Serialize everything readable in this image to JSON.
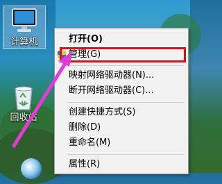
{
  "desktop": {
    "icons": [
      {
        "label": "计算机"
      },
      {
        "label": "回收站"
      }
    ]
  },
  "context_menu": {
    "items": [
      {
        "label": "打开(O)"
      },
      {
        "label": "管理(G)"
      },
      {
        "label": "映射网络驱动器(N)..."
      },
      {
        "label": "断开网络驱动器(C)..."
      },
      {
        "label": "创建快捷方式(S)"
      },
      {
        "label": "删除(D)"
      },
      {
        "label": "重命名(M)"
      },
      {
        "label": "属性(R)"
      }
    ]
  },
  "colors": {
    "highlight": "#d0141e",
    "arrow": "#e23cd6"
  }
}
